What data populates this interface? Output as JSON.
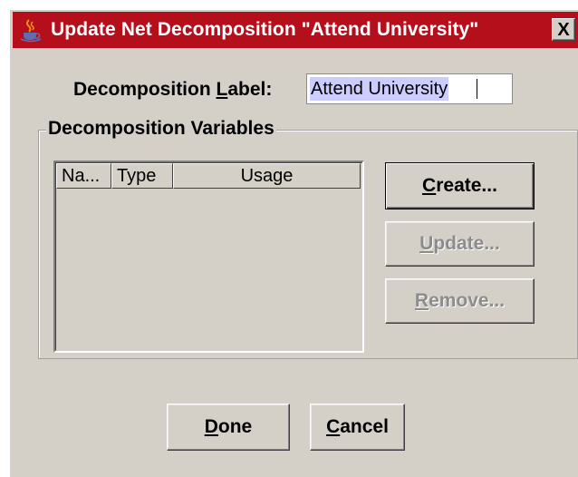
{
  "window": {
    "title": "Update Net Decomposition  \"Attend University\"",
    "close_label": "X",
    "title_icon": "java-coffee-cup-icon",
    "title_bar_color": "#b50f1c"
  },
  "label_row": {
    "label_prefix": "Decomposition ",
    "label_mnemonic": "L",
    "label_suffix": "abel:",
    "value": "Attend University"
  },
  "variables": {
    "group_title": "Decomposition Variables",
    "columns": [
      "Na...",
      "Type",
      "Usage"
    ],
    "rows": []
  },
  "buttons": {
    "create": {
      "mnemonic": "C",
      "rest": "reate...",
      "enabled": true
    },
    "update": {
      "mnemonic": "U",
      "rest": "pdate...",
      "enabled": false
    },
    "remove": {
      "mnemonic": "R",
      "rest": "emove...",
      "enabled": false
    },
    "done": {
      "mnemonic": "D",
      "rest": "one"
    },
    "cancel": {
      "mnemonic": "C",
      "rest": "ancel"
    }
  }
}
